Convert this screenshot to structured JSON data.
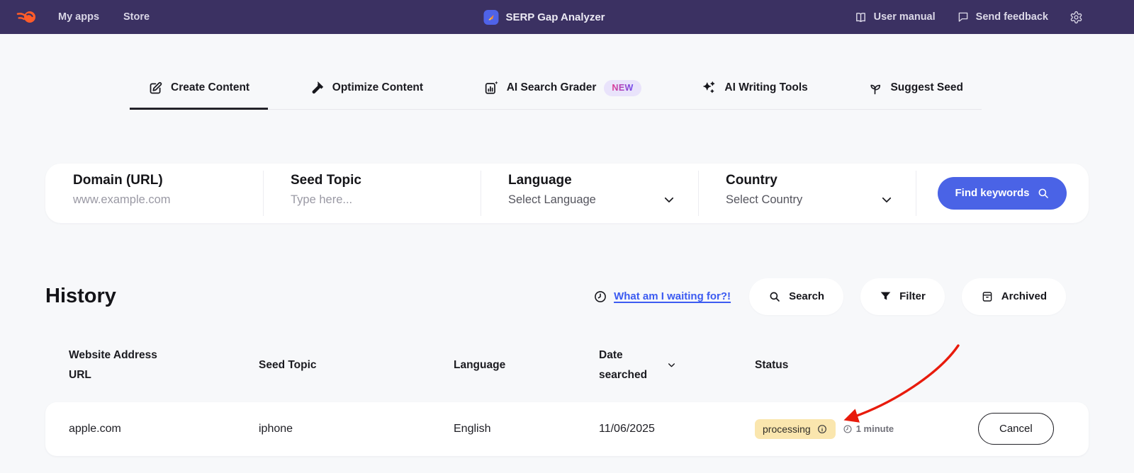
{
  "topbar": {
    "brand": "Semrush",
    "nav": [
      {
        "label": "My apps"
      },
      {
        "label": "Store"
      }
    ],
    "app": {
      "title": "SERP Gap Analyzer"
    },
    "actions": [
      {
        "label": "User manual"
      },
      {
        "label": "Send feedback"
      }
    ]
  },
  "tabs": [
    {
      "label": "Create Content",
      "active": true
    },
    {
      "label": "Optimize Content",
      "active": false
    },
    {
      "label": "AI Search Grader",
      "active": false,
      "badge": "NEW"
    },
    {
      "label": "AI Writing Tools",
      "active": false
    },
    {
      "label": "Suggest Seed",
      "active": false
    }
  ],
  "form": {
    "fields": [
      {
        "label": "Domain (URL)",
        "placeholder": "www.example.com",
        "type": "text"
      },
      {
        "label": "Seed Topic",
        "placeholder": "Type here...",
        "type": "text"
      },
      {
        "label": "Language",
        "value": "Select Language",
        "type": "select"
      },
      {
        "label": "Country",
        "value": "Select Country",
        "type": "select"
      }
    ],
    "submit": {
      "label": "Find keywords"
    }
  },
  "history": {
    "title": "History",
    "waiting_link": {
      "label": "What am I waiting for?!"
    },
    "toolbar": [
      {
        "label": "Search"
      },
      {
        "label": "Filter"
      },
      {
        "label": "Archived"
      }
    ]
  },
  "table": {
    "headers": {
      "website": "Website Address URL",
      "seed": "Seed Topic",
      "language": "Language",
      "date": "Date searched",
      "status": "Status"
    },
    "rows": [
      {
        "website": "apple.com",
        "seed": "iphone",
        "language": "English",
        "date": "11/06/2025",
        "status": "processing",
        "elapsed": "1 minute",
        "action": "Cancel"
      }
    ]
  },
  "colors": {
    "topbar_bg": "#3b3162",
    "accent_blue": "#4a63e6",
    "link_blue": "#3c5bf1",
    "badge_new_bg": "#e9e3fb",
    "badge_new_gradient_start": "#e23a8e",
    "badge_new_gradient_end": "#6d4bf0",
    "status_processing_bg": "#fae6ae",
    "arrow_red": "#e81b0c",
    "page_bg": "#f7f8fa",
    "logo_orange": "#ff5c29"
  }
}
